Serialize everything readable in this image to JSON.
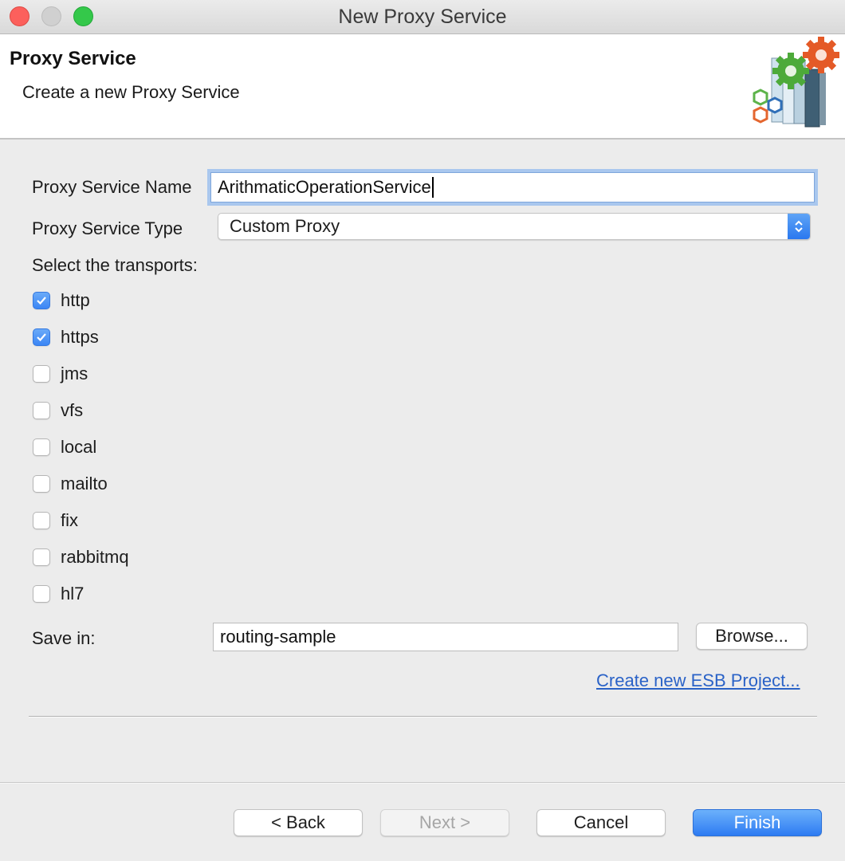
{
  "window": {
    "title": "New Proxy Service"
  },
  "header": {
    "title": "Proxy Service",
    "description": "Create a new Proxy Service",
    "icon": "wizard-gears-icon"
  },
  "form": {
    "name_label": "Proxy Service Name",
    "name_value": "ArithmaticOperationService",
    "type_label": "Proxy Service Type",
    "type_value": "Custom Proxy",
    "transports_label": "Select the transports:",
    "transports": [
      {
        "label": "http",
        "checked": true
      },
      {
        "label": "https",
        "checked": true
      },
      {
        "label": "jms",
        "checked": false
      },
      {
        "label": "vfs",
        "checked": false
      },
      {
        "label": "local",
        "checked": false
      },
      {
        "label": "mailto",
        "checked": false
      },
      {
        "label": "fix",
        "checked": false
      },
      {
        "label": "rabbitmq",
        "checked": false
      },
      {
        "label": "hl7",
        "checked": false
      }
    ],
    "save_in_label": "Save in:",
    "save_in_value": "routing-sample",
    "browse_label": "Browse...",
    "create_project_link": "Create new ESB Project..."
  },
  "buttons": {
    "back": "< Back",
    "next": "Next >",
    "cancel": "Cancel",
    "finish": "Finish"
  },
  "colors": {
    "accent": "#3b86f5",
    "link": "#2a62c7",
    "close": "#fc605c",
    "maximize": "#34c84a"
  }
}
